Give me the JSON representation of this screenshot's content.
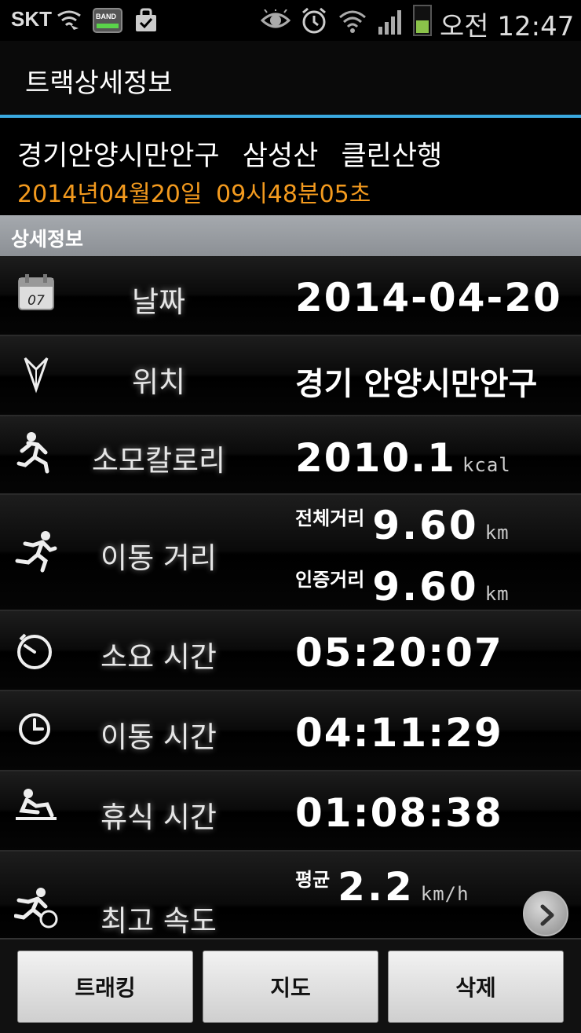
{
  "status_bar": {
    "carrier": "SKT",
    "band_label": "BAND",
    "time": "오전 12:47",
    "icons": [
      "wifi-direct-icon",
      "band-app-icon",
      "shopping-bag-icon",
      "eye-icon",
      "alarm-icon",
      "wifi-icon",
      "signal-icon",
      "battery-icon"
    ]
  },
  "header": {
    "title": "트랙상세정보"
  },
  "track": {
    "name": "경기안양시만안구 삼성산 클린산행",
    "datetime": "2014년04월20일 09시48분05초"
  },
  "section": {
    "label": "상세정보"
  },
  "rows": {
    "date": {
      "label": "날짜",
      "value": "2014-04-20",
      "icon": "calendar-icon",
      "icon_text": "07"
    },
    "location": {
      "label": "위치",
      "value": "경기 안양시만안구",
      "icon": "location-arrow-icon"
    },
    "calories": {
      "label": "소모칼로리",
      "value": "2010.1",
      "unit": "kcal",
      "icon": "runner-icon"
    },
    "distance": {
      "label": "이동 거리",
      "icon": "running-man-icon",
      "total_label": "전체거리",
      "total_value": "9.60",
      "total_unit": "km",
      "cert_label": "인증거리",
      "cert_value": "9.60",
      "cert_unit": "km"
    },
    "elapsed": {
      "label": "소요 시간",
      "value": "05:20:07",
      "icon": "stopwatch-icon"
    },
    "moving": {
      "label": "이동 시간",
      "value": "04:11:29",
      "icon": "clock-icon"
    },
    "rest": {
      "label": "휴식 시간",
      "value": "01:08:38",
      "icon": "resting-person-icon"
    },
    "speed": {
      "label": "최고 속도",
      "icon": "speed-runner-icon",
      "avg_label": "평균",
      "avg_value": "2.2",
      "avg_unit": "km/h"
    }
  },
  "buttons": {
    "tracking": "트래킹",
    "map": "지도",
    "delete": "삭제"
  },
  "colors": {
    "accent_line": "#3aa9e0",
    "date_text": "#f39a1e"
  }
}
